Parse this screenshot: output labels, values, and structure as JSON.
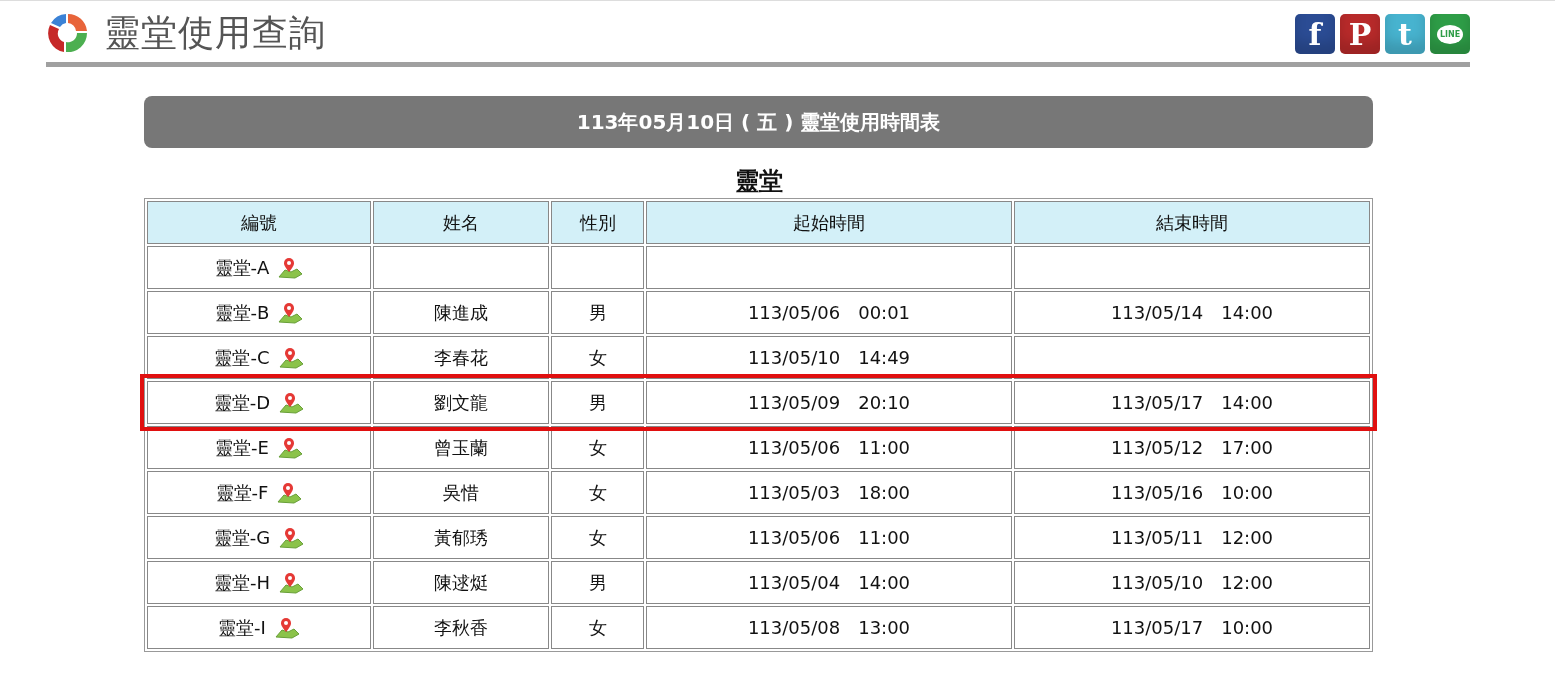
{
  "page": {
    "title": "靈堂使用查詢"
  },
  "share_icons": [
    {
      "kind": "facebook",
      "label": "f"
    },
    {
      "kind": "plurk",
      "label": "P"
    },
    {
      "kind": "twitter",
      "label": "t"
    },
    {
      "kind": "line",
      "label": "LINE"
    }
  ],
  "banner": "113年05月10日 ( 五 ) 靈堂使用時間表",
  "table": {
    "caption": "靈堂",
    "columns": [
      "編號",
      "姓名",
      "性別",
      "起始時間",
      "結束時間"
    ],
    "rows": [
      {
        "hall": "靈堂-A",
        "name": "",
        "gender": "",
        "start": "",
        "end": "",
        "highlighted": false
      },
      {
        "hall": "靈堂-B",
        "name": "陳進成",
        "gender": "男",
        "start": "113/05/06　00:01",
        "end": "113/05/14　14:00",
        "highlighted": false
      },
      {
        "hall": "靈堂-C",
        "name": "李春花",
        "gender": "女",
        "start": "113/05/10　14:49",
        "end": "",
        "highlighted": false
      },
      {
        "hall": "靈堂-D",
        "name": "劉文龍",
        "gender": "男",
        "start": "113/05/09　20:10",
        "end": "113/05/17　14:00",
        "highlighted": true
      },
      {
        "hall": "靈堂-E",
        "name": "曾玉蘭",
        "gender": "女",
        "start": "113/05/06　11:00",
        "end": "113/05/12　17:00",
        "highlighted": false
      },
      {
        "hall": "靈堂-F",
        "name": "吳惜",
        "gender": "女",
        "start": "113/05/03　18:00",
        "end": "113/05/16　10:00",
        "highlighted": false
      },
      {
        "hall": "靈堂-G",
        "name": "黃郁琇",
        "gender": "女",
        "start": "113/05/06　11:00",
        "end": "113/05/11　12:00",
        "highlighted": false
      },
      {
        "hall": "靈堂-H",
        "name": "陳逑烶",
        "gender": "男",
        "start": "113/05/04　14:00",
        "end": "113/05/10　12:00",
        "highlighted": false
      },
      {
        "hall": "靈堂-I",
        "name": "李秋香",
        "gender": "女",
        "start": "113/05/08　13:00",
        "end": "113/05/17　10:00",
        "highlighted": false
      }
    ]
  }
}
